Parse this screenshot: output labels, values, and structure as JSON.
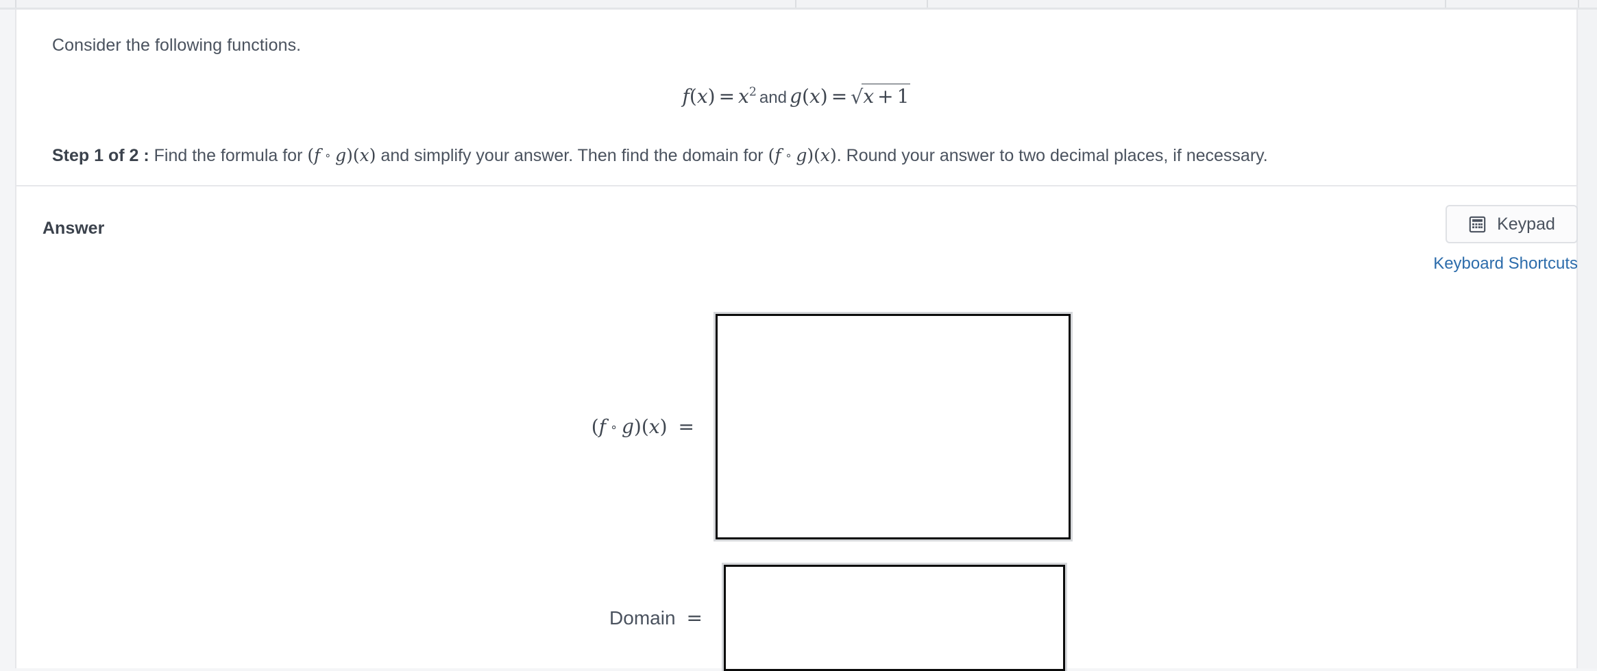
{
  "question": {
    "prompt": "Consider the following functions.",
    "formula": {
      "f_name": "f",
      "f_arg": "x",
      "f_body": "x",
      "f_exponent": "2",
      "conjunction": "and",
      "g_name": "g",
      "g_arg": "x",
      "g_radicand_var": "x",
      "g_radicand_op": "+",
      "g_radicand_const": "1",
      "equals": "=",
      "radical_sign": "√",
      "open_paren": "(",
      "close_paren": ")",
      "plain": "f(x) = x² and g(x) = √(x + 1)"
    },
    "step_label": "Step 1 of 2 :",
    "step_text_1": "Find the formula for",
    "step_text_2": "and simplify your answer. Then find the domain for",
    "step_text_3": ". Round your answer to two decimal places, if necessary.",
    "composition": {
      "open_paren": "(",
      "f": "f",
      "ring": "∘",
      "g": "g",
      "close_paren": ")",
      "arg_open": "(",
      "arg": "x",
      "arg_close": ")",
      "plain": "(f ∘ g)(x)"
    }
  },
  "answer": {
    "title": "Answer",
    "keypad_button": {
      "label": "Keypad",
      "icon": "calculator-icon"
    },
    "keyboard_shortcuts_link": "Keyboard Shortcuts",
    "fields": [
      {
        "label_plain": "(f ∘ g)(x)  =",
        "equals": "=",
        "value": "",
        "placeholder": ""
      },
      {
        "label_plain": "Domain  =",
        "label_text": "Domain",
        "equals": "=",
        "value": "",
        "placeholder": ""
      }
    ]
  },
  "colors": {
    "page_background": "#f4f5f7",
    "card_background": "#ffffff",
    "text": "#4a525e",
    "heading": "#3b424c",
    "link": "#2c6cab",
    "divider": "#e6e7ea",
    "input_border": "#0b0b0b",
    "input_outline": "#d6d8db",
    "button_border": "#dfe1e5"
  }
}
